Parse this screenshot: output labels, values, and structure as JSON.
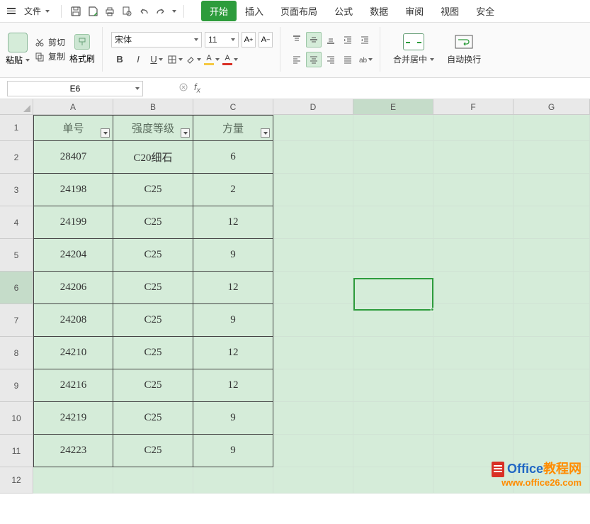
{
  "menu": {
    "file": "文件",
    "tabs": [
      "开始",
      "插入",
      "页面布局",
      "公式",
      "数据",
      "审阅",
      "视图",
      "安全"
    ]
  },
  "ribbon": {
    "paste": "粘贴",
    "cut": "剪切",
    "copy": "复制",
    "format_painter": "格式刷",
    "font_name": "宋体",
    "font_size": "11",
    "merge": "合并居中",
    "wrap": "自动换行"
  },
  "name_box": "E6",
  "columns": [
    "A",
    "B",
    "C",
    "D",
    "E",
    "F",
    "G"
  ],
  "row_labels": [
    "1",
    "2",
    "3",
    "4",
    "5",
    "6",
    "7",
    "8",
    "9",
    "10",
    "11",
    "12"
  ],
  "headers": [
    "单号",
    "强度等级",
    "方量"
  ],
  "rows": [
    [
      "28407",
      "C20细石",
      "6"
    ],
    [
      "24198",
      "C25",
      "2"
    ],
    [
      "24199",
      "C25",
      "12"
    ],
    [
      "24204",
      "C25",
      "9"
    ],
    [
      "24206",
      "C25",
      "12"
    ],
    [
      "24208",
      "C25",
      "9"
    ],
    [
      "24210",
      "C25",
      "12"
    ],
    [
      "24216",
      "C25",
      "12"
    ],
    [
      "24219",
      "C25",
      "9"
    ],
    [
      "24223",
      "C25",
      "9"
    ]
  ],
  "watermark": {
    "line1_a": "Office",
    "line1_b": "教程网",
    "line2": "www.office26.com"
  },
  "active_col_index": 4,
  "active_row_index": 5
}
